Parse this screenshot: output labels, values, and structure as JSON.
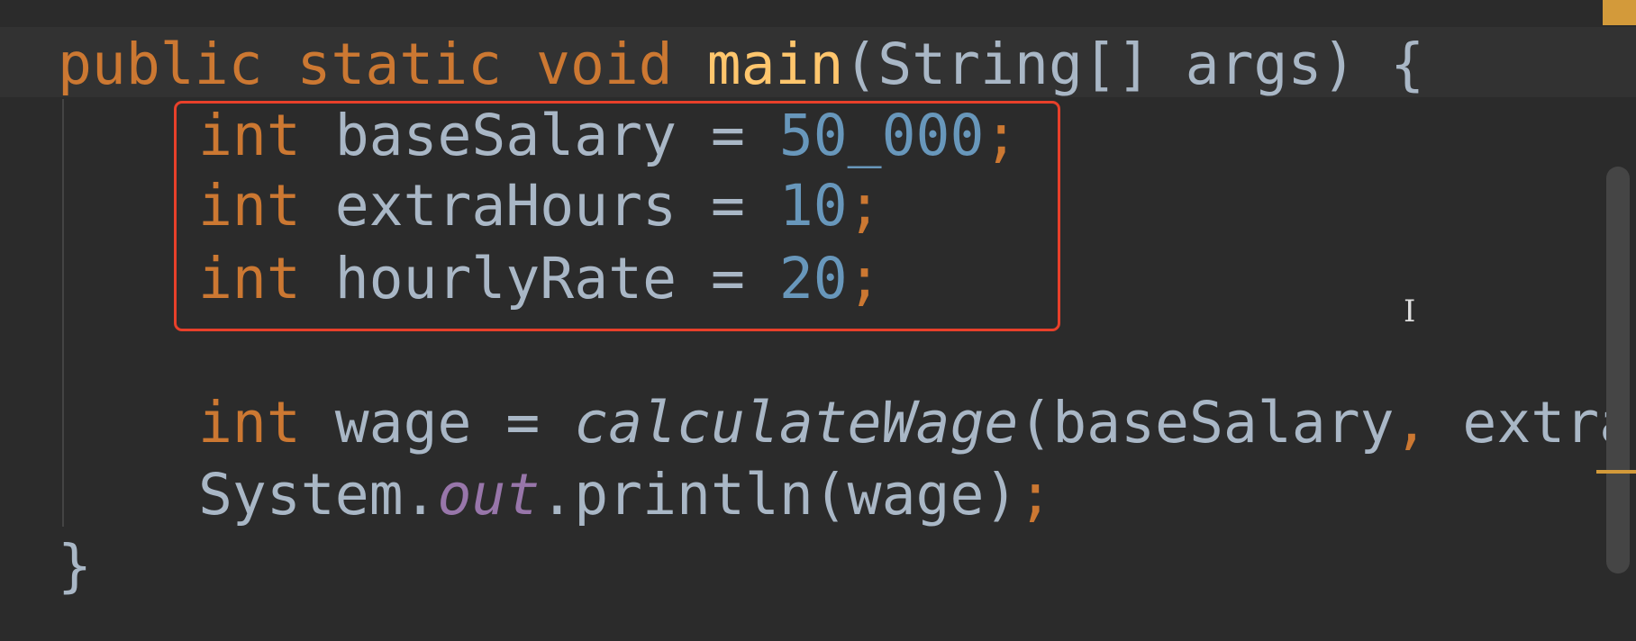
{
  "editor": {
    "colors": {
      "background": "#2b2b2b",
      "keyword": "#cc7832",
      "identifier": "#a9b7c6",
      "number": "#6897bb",
      "method": "#ffc66d",
      "field": "#9876aa",
      "highlight_box": "#e8402a"
    },
    "lines": [
      {
        "indent": 0,
        "tokens": [
          [
            "kw",
            "public static void "
          ],
          [
            "fn",
            "main"
          ],
          [
            "id",
            "(String[] args) {"
          ]
        ]
      },
      {
        "indent": 1,
        "tokens": [
          [
            "kw",
            "int "
          ],
          [
            "id",
            "baseSalary = "
          ],
          [
            "num",
            "50_000"
          ],
          [
            "punct",
            ";"
          ]
        ]
      },
      {
        "indent": 1,
        "tokens": [
          [
            "kw",
            "int "
          ],
          [
            "id",
            "extraHours = "
          ],
          [
            "num",
            "10"
          ],
          [
            "punct",
            ";"
          ]
        ]
      },
      {
        "indent": 1,
        "tokens": [
          [
            "kw",
            "int "
          ],
          [
            "id",
            "hourlyRate = "
          ],
          [
            "num",
            "20"
          ],
          [
            "punct",
            ";"
          ]
        ]
      },
      {
        "indent": 1,
        "tokens": []
      },
      {
        "indent": 1,
        "tokens": [
          [
            "kw",
            "int "
          ],
          [
            "id",
            "wage = "
          ],
          [
            "call",
            "calculateWage"
          ],
          [
            "id",
            "(baseSalary"
          ],
          [
            "punct",
            ","
          ],
          [
            "id",
            " extra"
          ]
        ]
      },
      {
        "indent": 1,
        "tokens": [
          [
            "id",
            "System."
          ],
          [
            "field",
            "out"
          ],
          [
            "id",
            ".println(wage)"
          ],
          [
            "punct",
            ";"
          ]
        ]
      },
      {
        "indent": 0,
        "tokens": [
          [
            "id",
            "}"
          ]
        ]
      }
    ],
    "cursor_icon": "text-cursor-icon"
  }
}
